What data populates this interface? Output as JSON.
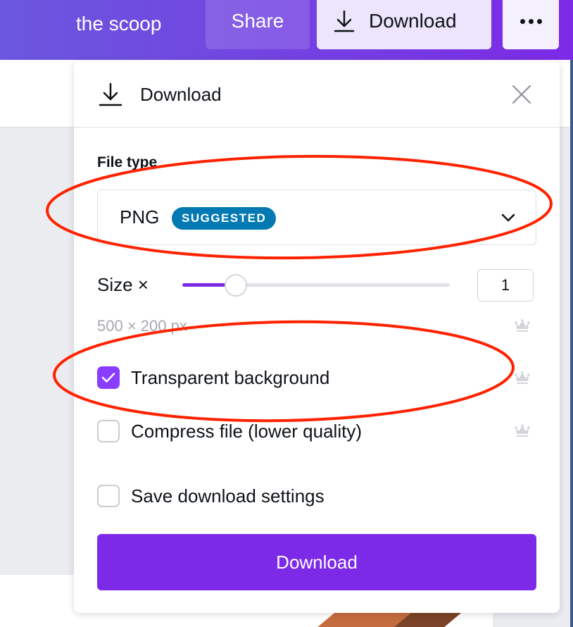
{
  "topbar": {
    "doc_title": "the scoop",
    "share_label": "Share",
    "download_label": "Download",
    "download_icon": "download-icon",
    "more_icon": "more-horizontal-icon"
  },
  "panel": {
    "title": "Download",
    "title_icon": "download-icon",
    "close_icon": "close-icon",
    "file_type": {
      "label": "File type",
      "value": "PNG",
      "badge": "SUGGESTED",
      "chevron_icon": "chevron-down-icon"
    },
    "size": {
      "label": "Size ×",
      "value": "1",
      "slider_fraction": 0.2,
      "dimensions": "500 × 200 px",
      "premium_icon": "crown-icon"
    },
    "options": [
      {
        "label": "Transparent background",
        "checked": true,
        "premium": true
      },
      {
        "label": "Compress file (lower quality)",
        "checked": false,
        "premium": true
      },
      {
        "label": "Save download settings",
        "checked": false,
        "premium": false
      }
    ],
    "submit_label": "Download"
  },
  "colors": {
    "brand_purple": "#7d2ae8",
    "checkbox_purple": "#8b3dff",
    "badge_blue": "#0279b2",
    "annotation_red": "#ff2200"
  }
}
